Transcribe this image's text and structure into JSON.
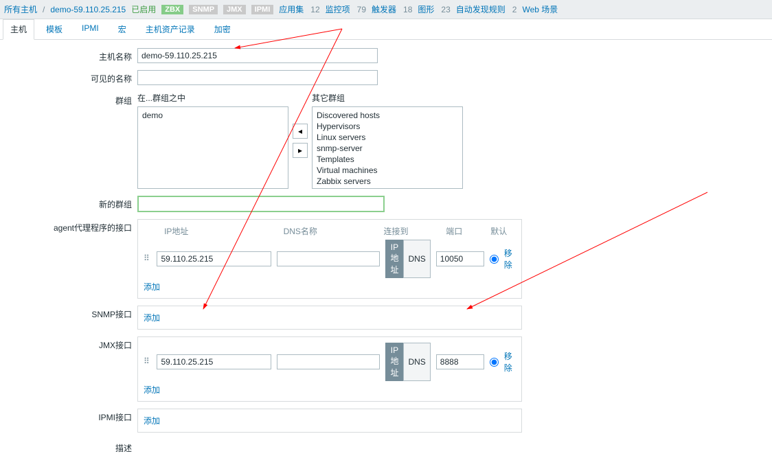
{
  "breadcrumb": {
    "all_hosts": "所有主机",
    "host": "demo-59.110.25.215"
  },
  "status": "已启用",
  "badges": {
    "zbx": "ZBX",
    "snmp": "SNMP",
    "jmx": "JMX",
    "ipmi": "IPMI"
  },
  "counts": {
    "apps_label": "应用集",
    "apps": "12",
    "items_label": "监控项",
    "items": "79",
    "triggers_label": "触发器",
    "triggers": "18",
    "graphs_label": "图形",
    "graphs": "23",
    "discovery_label": "自动发现规则",
    "discovery": "2",
    "web_label": "Web 场景",
    "web": ""
  },
  "tabs": [
    "主机",
    "模板",
    "IPMI",
    "宏",
    "主机资产记录",
    "加密"
  ],
  "labels": {
    "host_name": "主机名称",
    "visible_name": "可见的名称",
    "groups": "群组",
    "in_groups": "在...群组之中",
    "other_groups": "其它群组",
    "new_group": "新的群组",
    "agent": "agent代理程序的接口",
    "snmp": "SNMP接口",
    "jmx": "JMX接口",
    "ipmi": "IPMI接口",
    "desc": "描述",
    "ip": "IP地址",
    "dns": "DNS名称",
    "connect": "连接到",
    "port": "端口",
    "default": "默认",
    "btn_ip": "IP地址",
    "btn_dns": "DNS",
    "add": "添加",
    "remove": "移除"
  },
  "host_name_value": "demo-59.110.25.215",
  "visible_name_value": "",
  "groups_in": [
    "demo"
  ],
  "groups_other": [
    "Discovered hosts",
    "Hypervisors",
    "Linux servers",
    "snmp-server",
    "Templates",
    "Virtual machines",
    "Zabbix servers"
  ],
  "new_group_value": "",
  "agent_iface": {
    "ip": "59.110.25.215",
    "dns": "",
    "port": "10050"
  },
  "jmx_iface": {
    "ip": "59.110.25.215",
    "dns": "",
    "port": "8888"
  }
}
